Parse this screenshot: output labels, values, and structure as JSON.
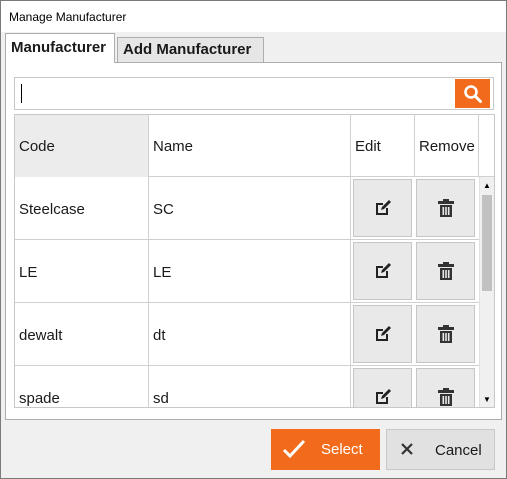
{
  "window": {
    "title": "Manage Manufacturer"
  },
  "tabs": [
    {
      "label": "Manufacturer",
      "active": true
    },
    {
      "label": "Add Manufacturer",
      "active": false
    }
  ],
  "search": {
    "value": "",
    "placeholder": "",
    "icon": "search-icon"
  },
  "table": {
    "columns": [
      "Code",
      "Name",
      "Edit",
      "Remove"
    ],
    "rows": [
      {
        "code": "Steelcase",
        "name": "SC"
      },
      {
        "code": "LE",
        "name": "LE"
      },
      {
        "code": "dewalt",
        "name": "dt"
      },
      {
        "code": "spade",
        "name": "sd"
      }
    ],
    "edit_icon": "edit-icon",
    "remove_icon": "trash-icon"
  },
  "footer": {
    "select_label": "Select",
    "cancel_label": "Cancel"
  },
  "colors": {
    "accent": "#f26a1b",
    "cancel_bg": "#e1e1e1"
  }
}
